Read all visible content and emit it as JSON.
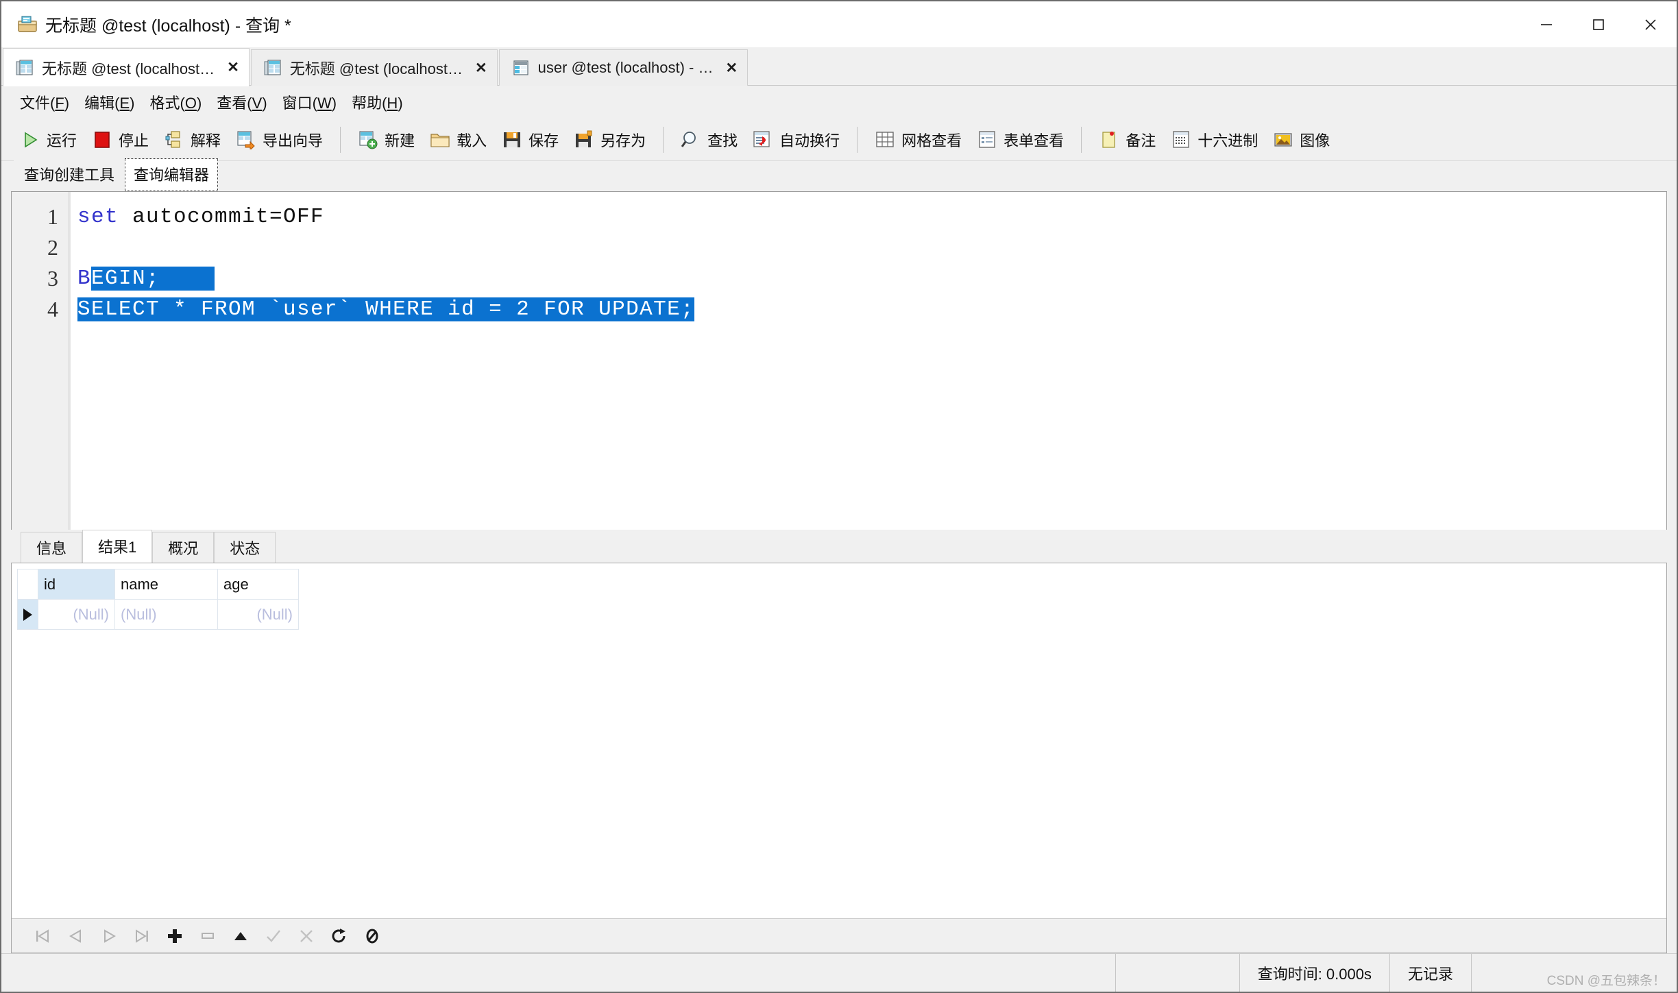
{
  "window": {
    "title": "无标题 @test (localhost) - 查询 *",
    "icon": "query-window-icon",
    "minimize": "−",
    "maximize": "□",
    "close": "✕"
  },
  "tabs": [
    {
      "label": "无标题 @test (localhost…",
      "icon": "query-tab-icon",
      "close": "✕",
      "active": true
    },
    {
      "label": "无标题 @test (localhost…",
      "icon": "query-tab-icon",
      "close": "✕",
      "active": false
    },
    {
      "label": "user @test (localhost) - …",
      "icon": "table-tab-icon",
      "close": "✕",
      "active": false
    }
  ],
  "menu": [
    {
      "text": "文件",
      "mnemonic": "F"
    },
    {
      "text": "编辑",
      "mnemonic": "E"
    },
    {
      "text": "格式",
      "mnemonic": "O"
    },
    {
      "text": "查看",
      "mnemonic": "V"
    },
    {
      "text": "窗口",
      "mnemonic": "W"
    },
    {
      "text": "帮助",
      "mnemonic": "H"
    }
  ],
  "toolbar": [
    {
      "label": "运行",
      "icon": "play-icon"
    },
    {
      "label": "停止",
      "icon": "stop-icon"
    },
    {
      "label": "解释",
      "icon": "explain-icon"
    },
    {
      "label": "导出向导",
      "icon": "export-wizard-icon"
    },
    {
      "sep": true
    },
    {
      "label": "新建",
      "icon": "new-query-icon"
    },
    {
      "label": "载入",
      "icon": "open-folder-icon"
    },
    {
      "label": "保存",
      "icon": "save-icon"
    },
    {
      "label": "另存为",
      "icon": "save-as-icon"
    },
    {
      "sep": true
    },
    {
      "label": "查找",
      "icon": "search-icon"
    },
    {
      "label": "自动换行",
      "icon": "word-wrap-icon"
    },
    {
      "sep": true
    },
    {
      "label": "网格查看",
      "icon": "grid-view-icon"
    },
    {
      "label": "表单查看",
      "icon": "form-view-icon"
    },
    {
      "sep": true
    },
    {
      "label": "备注",
      "icon": "memo-icon"
    },
    {
      "label": "十六进制",
      "icon": "hex-icon"
    },
    {
      "label": "图像",
      "icon": "image-icon"
    }
  ],
  "subtabs": [
    {
      "label": "查询创建工具",
      "active": false
    },
    {
      "label": "查询编辑器",
      "active": true
    }
  ],
  "editor": {
    "line_numbers": [
      "1",
      "2",
      "3",
      "4"
    ],
    "lines": [
      {
        "n": "1",
        "segments": [
          {
            "text": "set",
            "kind": "keyword"
          },
          {
            "text": " autocommit=OFF",
            "kind": "plain"
          }
        ]
      },
      {
        "n": "2",
        "segments": []
      },
      {
        "n": "3",
        "segments": [
          {
            "text": "B",
            "kind": "keyword"
          },
          {
            "text": "EGIN;",
            "kind": "selected"
          },
          {
            "text": "    ",
            "kind": "selected"
          }
        ]
      },
      {
        "n": "4",
        "segments": [
          {
            "text": "SELECT * FROM `user` WHERE id = 2 FOR UPDATE;",
            "kind": "selected"
          }
        ]
      }
    ],
    "selection_color": "#0b72d0",
    "keyword_color": "#3333cc"
  },
  "result_tabs": [
    {
      "label": "信息",
      "active": false
    },
    {
      "label": "结果1",
      "active": true
    },
    {
      "label": "概况",
      "active": false
    },
    {
      "label": "状态",
      "active": false
    }
  ],
  "result_grid": {
    "columns": [
      "id",
      "name",
      "age"
    ],
    "selected_column": "id",
    "rows": [
      {
        "marker": "▶",
        "cells": [
          "(Null)",
          "(Null)",
          "(Null)"
        ]
      }
    ],
    "header_highlight_color": "#d6e7f5"
  },
  "grid_nav": [
    {
      "icon": "first-record-icon",
      "enabled": false
    },
    {
      "icon": "previous-record-icon",
      "enabled": false
    },
    {
      "icon": "next-record-icon",
      "enabled": false
    },
    {
      "icon": "last-record-icon",
      "enabled": false
    },
    {
      "icon": "add-record-icon",
      "enabled": true
    },
    {
      "icon": "delete-record-icon",
      "enabled": false
    },
    {
      "icon": "apply-up-icon",
      "enabled": true
    },
    {
      "icon": "confirm-check-icon",
      "enabled": false
    },
    {
      "icon": "cancel-x-icon",
      "enabled": false
    },
    {
      "icon": "refresh-icon",
      "enabled": true
    },
    {
      "icon": "stop-null-icon",
      "enabled": true
    }
  ],
  "statusbar": {
    "query_time": "查询时间: 0.000s",
    "record_count": "无记录",
    "watermark": "CSDN @五包辣条！"
  }
}
